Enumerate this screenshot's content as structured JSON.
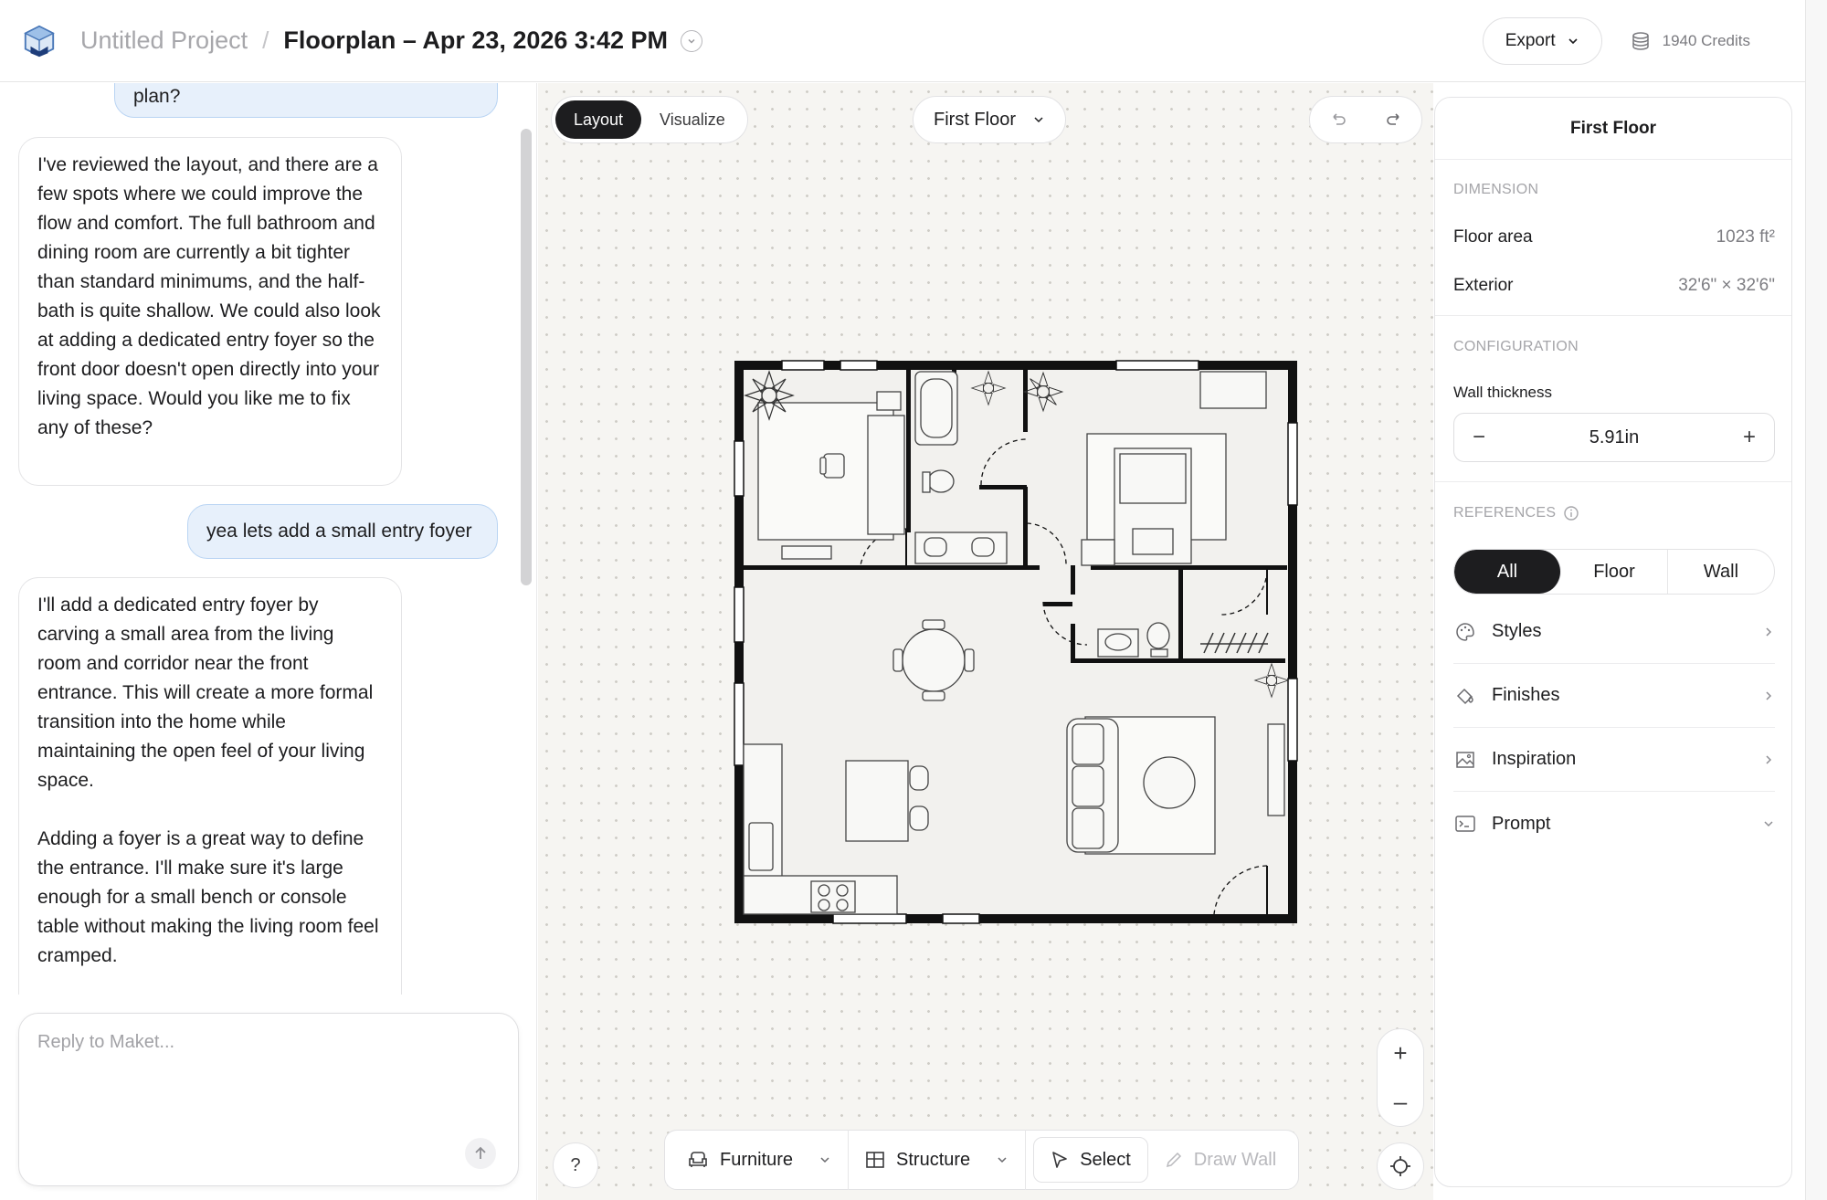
{
  "header": {
    "project": "Untitled Project",
    "separator": "/",
    "file": "Floorplan – Apr 23, 2026 3:42 PM",
    "export_label": "Export",
    "credits": "1940 Credits"
  },
  "chat": {
    "messages": [
      {
        "role": "user",
        "text": "plan?"
      },
      {
        "role": "ai",
        "text": "I've reviewed the layout, and there are a few spots where we could improve the flow and comfort. The full bathroom and dining room are currently a bit tighter than standard minimums, and the half-bath is quite shallow. We could also look at adding a dedicated entry foyer so the front door doesn't open directly into your living space. Would you like me to fix any of these?"
      },
      {
        "role": "user",
        "text": "yea lets add a small entry foyer"
      },
      {
        "role": "ai",
        "text": "I'll add a dedicated entry foyer by carving a small area from the living room and corridor near the front entrance. This will create a more formal transition into the home while maintaining the open feel of your living space."
      },
      {
        "role": "ai",
        "text": "Adding a foyer is a great way to define the entrance. I'll make sure it's large enough for a small bench or console table without making the living room feel cramped."
      }
    ],
    "reply_placeholder": "Reply to Maket..."
  },
  "canvas": {
    "modes": [
      "Layout",
      "Visualize"
    ],
    "active_mode": "Layout",
    "floor": "First Floor",
    "toolbar": {
      "furniture": "Furniture",
      "structure": "Structure",
      "select": "Select",
      "draw_wall": "Draw Wall"
    },
    "help": "?",
    "zoom_in": "+",
    "zoom_out": "–"
  },
  "props": {
    "title": "First Floor",
    "dimension_label": "DIMENSION",
    "floor_area_label": "Floor area",
    "floor_area_value": "1023 ft²",
    "exterior_label": "Exterior",
    "exterior_value": "32'6\" × 32'6\"",
    "configuration_label": "CONFIGURATION",
    "wall_thickness_label": "Wall thickness",
    "wall_thickness_value": "5.91in",
    "references_label": "REFERENCES",
    "ref_tabs": [
      "All",
      "Floor",
      "Wall"
    ],
    "ref_items": [
      "Styles",
      "Finishes",
      "Inspiration",
      "Prompt"
    ]
  },
  "colors": {
    "accent_dark": "#1d1d1f",
    "user_bubble": "#e7f0fb",
    "canvas_bg": "#f6f5f2"
  }
}
